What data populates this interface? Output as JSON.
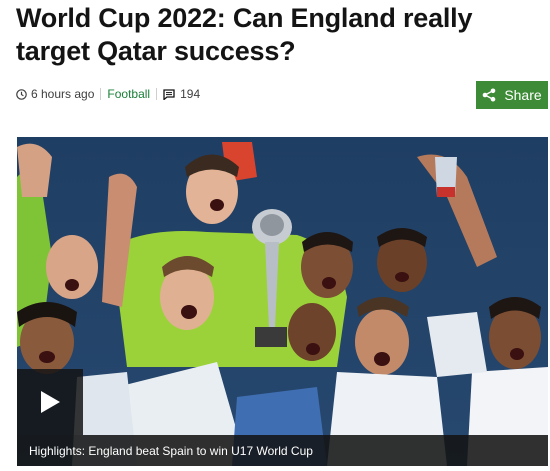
{
  "article": {
    "headline": "World Cup 2022: Can England really target Qatar success?",
    "meta": {
      "time": "6 hours ago",
      "topic": "Football",
      "comments": "194"
    },
    "share_label": "Share"
  },
  "media": {
    "caption": "Highlights: England beat Spain to win U17 World Cup",
    "play_icon": "play-icon"
  },
  "colors": {
    "share_bg": "#3d8b37",
    "topic_link": "#1a7f37",
    "caption_bg": "#141414"
  }
}
